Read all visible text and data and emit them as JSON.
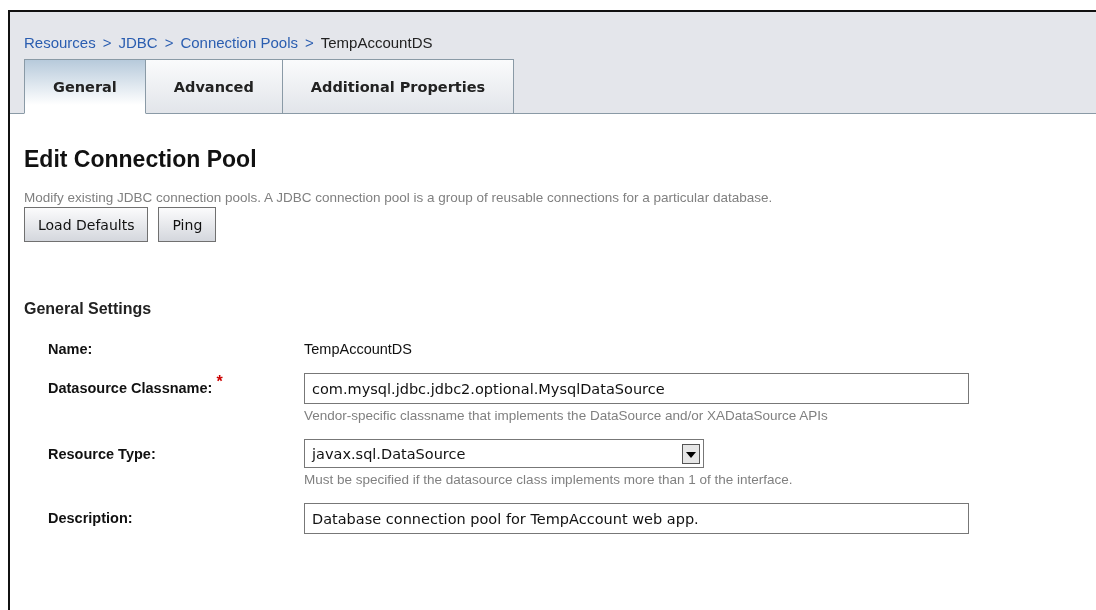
{
  "breadcrumb": {
    "links": [
      "Resources",
      "JDBC",
      "Connection Pools"
    ],
    "current": "TempAccountDS"
  },
  "separator": ">",
  "tabs": [
    {
      "label": "General",
      "selected": true
    },
    {
      "label": "Advanced",
      "selected": false
    },
    {
      "label": "Additional Properties",
      "selected": false
    }
  ],
  "page_title": "Edit Connection Pool",
  "page_description": "Modify existing JDBC connection pools. A JDBC connection pool is a group of reusable connections for a particular database.",
  "buttons": [
    "Load Defaults",
    "Ping"
  ],
  "section_title": "General Settings",
  "fields": [
    {
      "kind": "text",
      "label": "Name:",
      "value": "TempAccountDS"
    },
    {
      "kind": "input",
      "label": "Datasource Classname:",
      "required_mark": "*",
      "value": "com.mysql.jdbc.jdbc2.optional.MysqlDataSource",
      "help": "Vendor-specific classname that implements the DataSource and/or XADataSource APIs"
    },
    {
      "kind": "select",
      "label": "Resource Type:",
      "value": "javax.sql.DataSource",
      "help": "Must be specified if the datasource class implements more than 1 of the interface."
    },
    {
      "kind": "input",
      "label": "Description:",
      "value": "Database connection pool for TempAccount web app."
    }
  ]
}
